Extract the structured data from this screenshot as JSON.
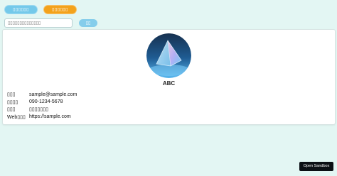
{
  "tabs": [
    {
      "label": "▯▯▯▯▯▯"
    },
    {
      "label": "▯▯▯▯▯▯"
    }
  ],
  "search": {
    "placeholder": "▯▯▯▯▯▯▯▯▯▯▯▯▯▯",
    "button_label": "▯▯"
  },
  "profile": {
    "name": "ABC",
    "fields": [
      {
        "label": "▯▯▯",
        "value": "sample@sample.com"
      },
      {
        "label": "▯▯▯▯",
        "value": "090-1234-5678"
      },
      {
        "label": "▯▯▯",
        "value": "▯▯▯▯▯▯▯"
      },
      {
        "label": "Web▯▯▯",
        "value": "https://sample.com"
      }
    ]
  },
  "footer": {
    "sandbox_label": "Open Sandbox"
  },
  "colors": {
    "background": "#e3f6f3",
    "tab_blue": "#74c9ea",
    "tab_orange": "#f3a21c",
    "button_dark": "#0b0f14"
  }
}
